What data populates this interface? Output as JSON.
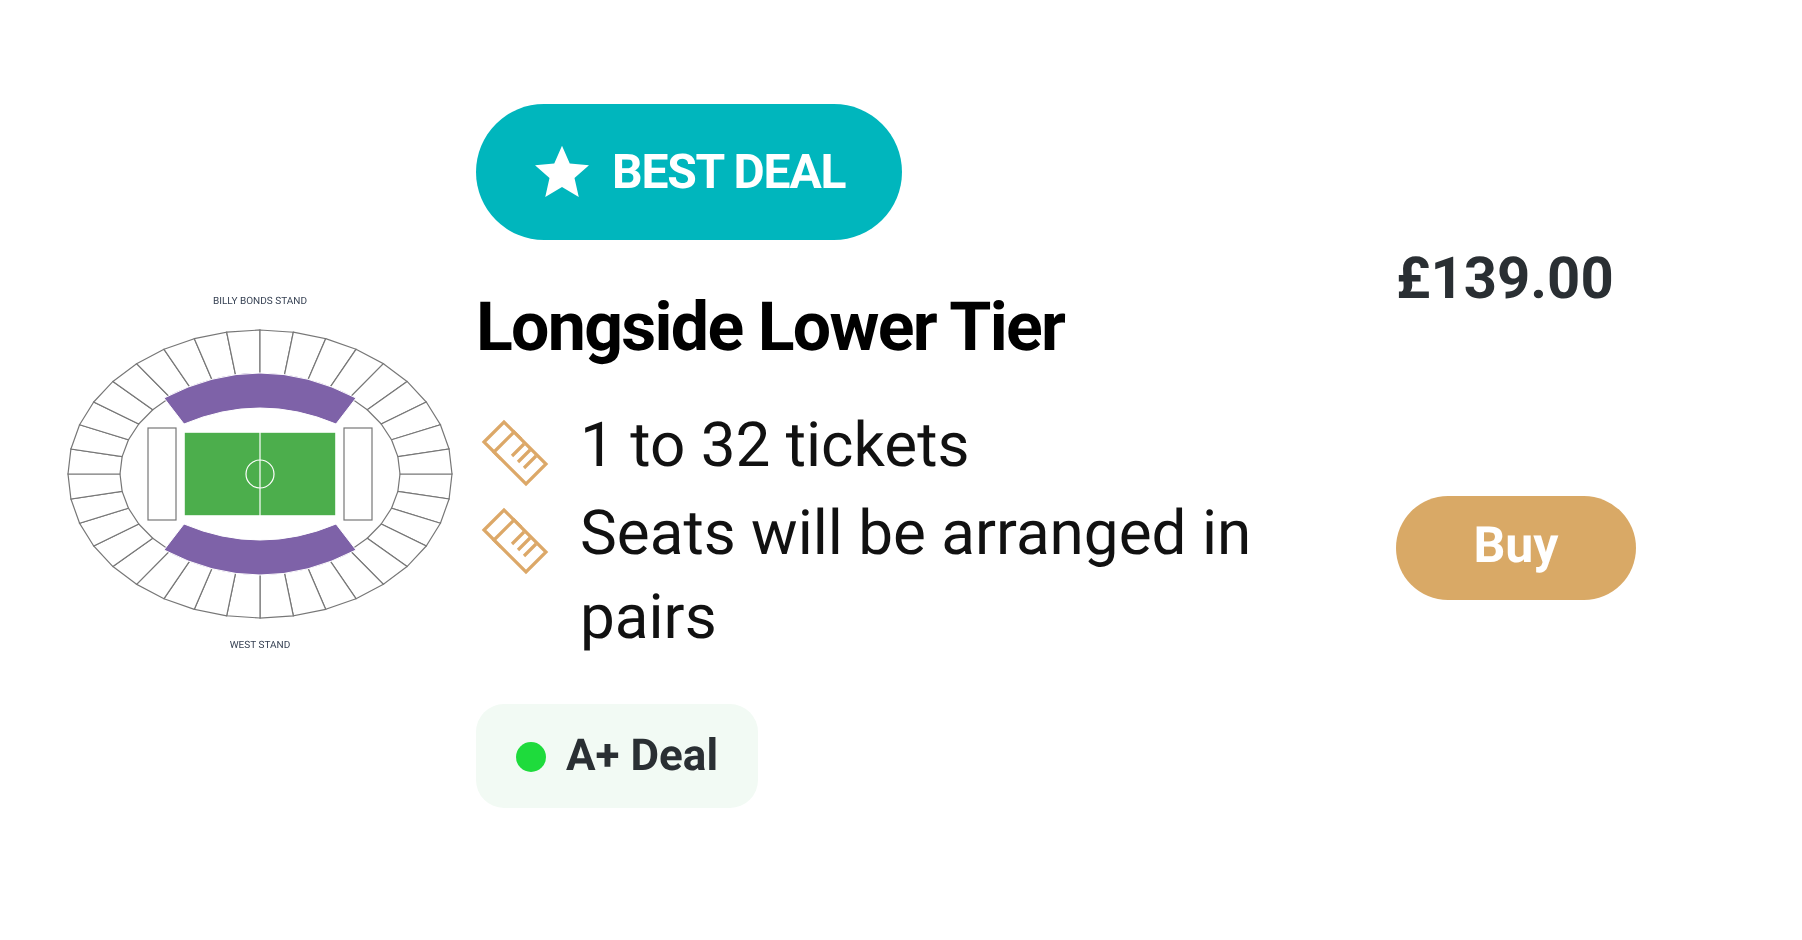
{
  "stadium_map": {
    "top_label": "BILLY BONDS STAND",
    "bottom_label": "WEST STAND"
  },
  "badge": {
    "label": "BEST DEAL"
  },
  "title": "Longside Lower Tier",
  "features": [
    {
      "text": "1 to 32 tickets"
    },
    {
      "text": "Seats will be arranged in pairs"
    }
  ],
  "rating": {
    "label": "A+ Deal",
    "color": "#1edb3c"
  },
  "price": "£139.00",
  "buy_button": {
    "label": "Buy"
  }
}
